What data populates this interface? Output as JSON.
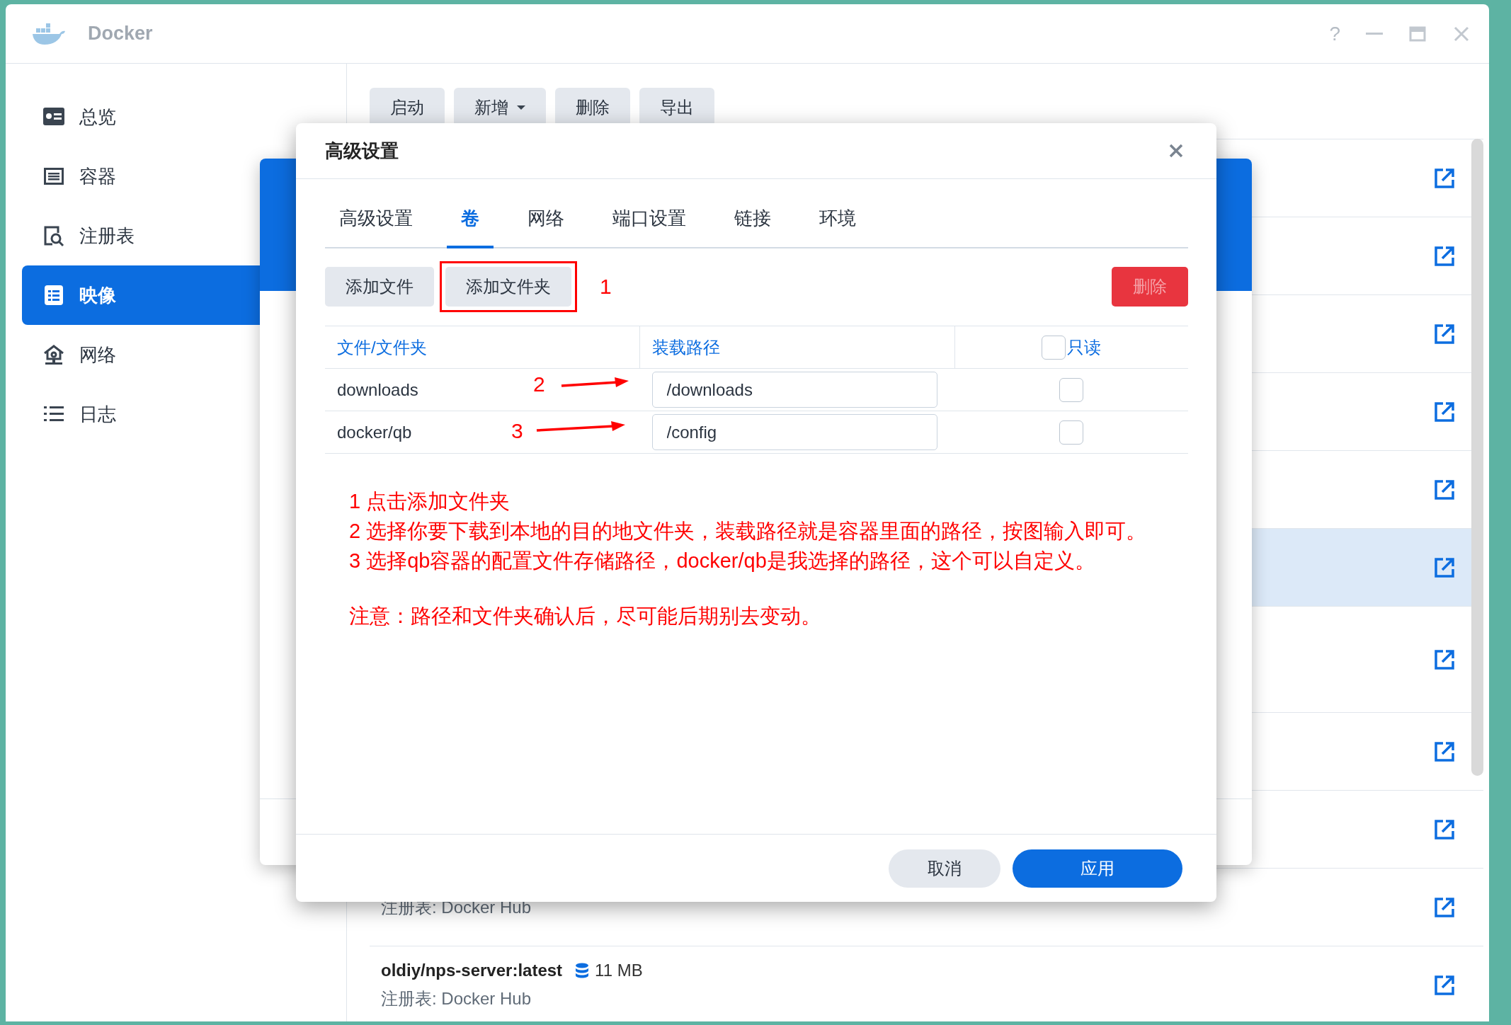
{
  "window": {
    "title": "Docker",
    "help": "?"
  },
  "sidebar": {
    "items": [
      {
        "label": "总览",
        "selected": false
      },
      {
        "label": "容器",
        "selected": false
      },
      {
        "label": "注册表",
        "selected": false
      },
      {
        "label": "映像",
        "selected": true
      },
      {
        "label": "网络",
        "selected": false
      },
      {
        "label": "日志",
        "selected": false
      }
    ]
  },
  "toolbar": {
    "buttons": [
      {
        "label": "启动",
        "dropdown": false
      },
      {
        "label": "新增",
        "dropdown": true
      },
      {
        "label": "删除",
        "dropdown": false
      },
      {
        "label": "导出",
        "dropdown": false
      }
    ]
  },
  "image_list": {
    "rows": [
      {
        "selected": false
      },
      {
        "selected": false
      },
      {
        "selected": false
      },
      {
        "selected": false
      },
      {
        "selected": false
      },
      {
        "selected": true
      },
      {
        "selected": false
      },
      {
        "selected": false
      },
      {
        "selected": false
      },
      {
        "registry": "注册表: Docker Hub",
        "selected": false
      },
      {
        "name": "oldiy/nps-server:latest",
        "size": "11 MB",
        "registry": "注册表: Docker Hub",
        "selected": false
      }
    ]
  },
  "dialog": {
    "title": "高级设置",
    "tabs": [
      {
        "label": "高级设置",
        "selected": false
      },
      {
        "label": "卷",
        "selected": true
      },
      {
        "label": "网络",
        "selected": false
      },
      {
        "label": "端口设置",
        "selected": false
      },
      {
        "label": "链接",
        "selected": false
      },
      {
        "label": "环境",
        "selected": false
      }
    ],
    "actions": [
      {
        "label": "添加文件",
        "marked": false
      },
      {
        "label": "添加文件夹",
        "marked": true
      }
    ],
    "delete_button": {
      "label": "删除",
      "disabled": true
    },
    "table": {
      "columns": [
        "文件/文件夹",
        "装载路径",
        "只读"
      ],
      "header_checked": false,
      "rows": [
        {
          "folder": "downloads",
          "mount_path": "/downloads",
          "read_only": false
        },
        {
          "folder": "docker/qb",
          "mount_path": "/config",
          "read_only": false
        }
      ]
    },
    "annotations": [
      "1",
      "2",
      "3"
    ],
    "notes": [
      "1 点击添加文件夹",
      "2 选择你要下载到本地的目的地文件夹，装载路径就是容器里面的路径，按图输入即可。",
      "3 选择qb容器的配置文件存储路径，docker/qb是我选择的路径，这个可以自定义。"
    ],
    "warning": "注意：路径和文件夹确认后，尽可能后期别去变动。",
    "buttons": [
      {
        "label": "取消",
        "kind": "secondary"
      },
      {
        "label": "应用",
        "kind": "primary"
      }
    ]
  }
}
